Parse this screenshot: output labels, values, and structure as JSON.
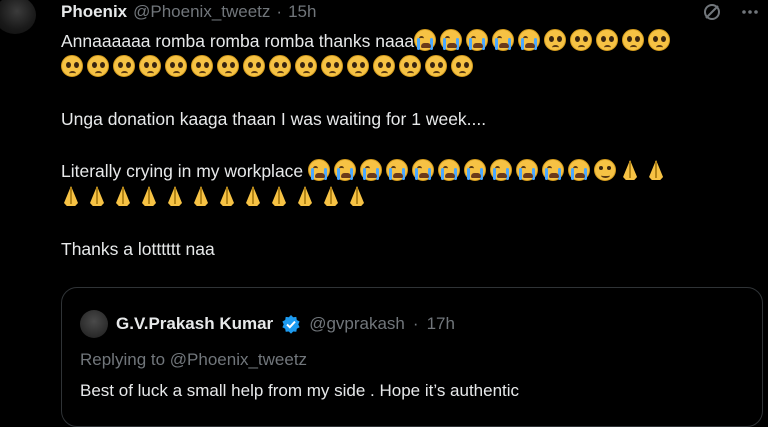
{
  "header": {
    "name": "Phoenix",
    "handle": "@Phoenix_tweetz",
    "separator": "·",
    "time": "15h"
  },
  "icons": {
    "avatar": "avatar",
    "grok": "grok-icon",
    "more": "more-icon"
  },
  "tweet": {
    "line1_text": "Annaaaaaa romba romba romba thanks naaa",
    "line1_emojis": [
      "loudly-crying-face",
      "loudly-crying-face",
      "loudly-crying-face",
      "loudly-crying-face",
      "loudly-crying-face",
      "pleading-face",
      "pleading-face",
      "pleading-face",
      "pleading-face",
      "pleading-face"
    ],
    "line2_emojis": [
      "pleading-face",
      "pleading-face",
      "pleading-face",
      "pleading-face",
      "pleading-face",
      "pleading-face",
      "pleading-face",
      "pleading-face",
      "pleading-face",
      "pleading-face",
      "pleading-face",
      "pleading-face",
      "pleading-face",
      "pleading-face",
      "pleading-face",
      "pleading-face"
    ],
    "line3_text": "Unga donation kaaga thaan I was waiting for 1 week....",
    "line4_text": "Literally crying in my workplace",
    "line4_emojis": [
      "loudly-crying-face",
      "loudly-crying-face",
      "loudly-crying-face",
      "loudly-crying-face",
      "loudly-crying-face",
      "loudly-crying-face",
      "loudly-crying-face",
      "loudly-crying-face",
      "loudly-crying-face",
      "loudly-crying-face",
      "loudly-crying-face",
      "holding-back-tears-face",
      "folded-hands",
      "folded-hands"
    ],
    "line5_emojis": [
      "folded-hands",
      "folded-hands",
      "folded-hands",
      "folded-hands",
      "folded-hands",
      "folded-hands",
      "folded-hands",
      "folded-hands",
      "folded-hands",
      "folded-hands",
      "folded-hands",
      "folded-hands"
    ],
    "line6_text": "Thanks a lotttttt naa"
  },
  "quote": {
    "name": "G.V.Prakash Kumar",
    "handle": "@gvprakash",
    "separator": "·",
    "time": "17h",
    "replying": "Replying to @Phoenix_tweetz",
    "text": "Best of luck a small help from my side . Hope it’s authentic",
    "verified_color": "#1d9bf0"
  }
}
